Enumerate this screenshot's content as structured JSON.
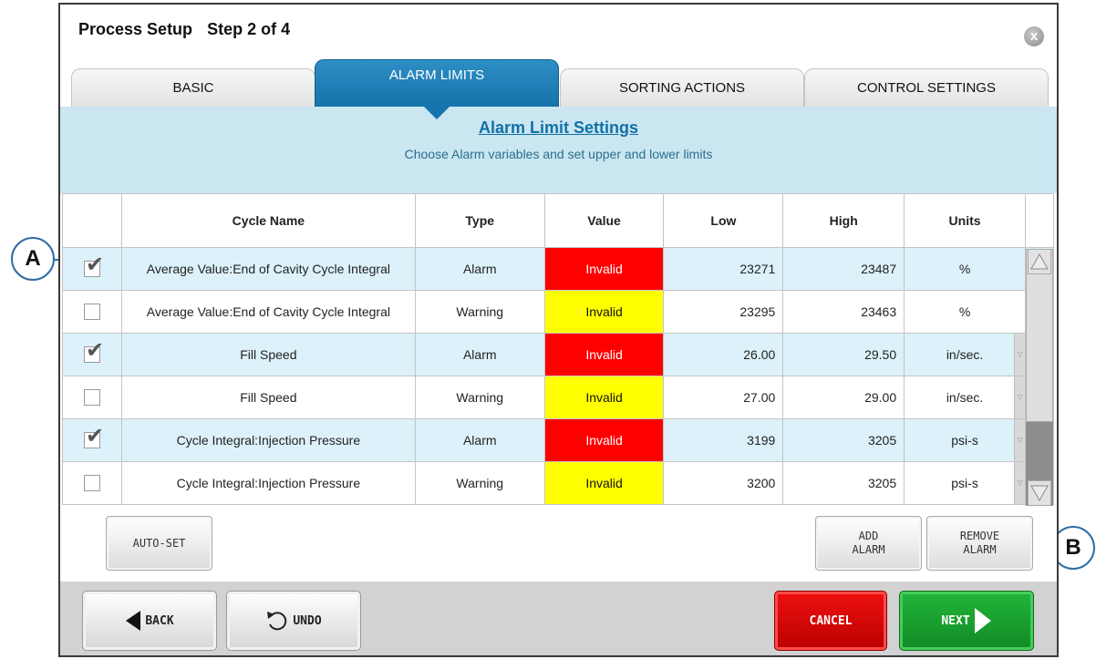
{
  "window": {
    "title": "Process Setup",
    "step": "Step 2 of 4",
    "close_glyph": "x"
  },
  "tabs": [
    {
      "label": "BASIC",
      "active": false
    },
    {
      "label": "ALARM LIMITS",
      "active": true
    },
    {
      "label": "SORTING ACTIONS",
      "active": false
    },
    {
      "label": "CONTROL SETTINGS",
      "active": false
    }
  ],
  "header": {
    "title": "Alarm Limit Settings",
    "subtitle": "Choose Alarm variables and set upper and lower limits"
  },
  "table": {
    "columns": [
      "",
      "Cycle Name",
      "Type",
      "Value",
      "Low",
      "High",
      "Units"
    ],
    "rows": [
      {
        "checked": true,
        "name": "Average Value:End of Cavity Cycle Integral",
        "type": "Alarm",
        "value": "Invalid",
        "low": "23271",
        "high": "23487",
        "units": "%",
        "dropdown": false
      },
      {
        "checked": false,
        "name": "Average Value:End of Cavity Cycle Integral",
        "type": "Warning",
        "value": "Invalid",
        "low": "23295",
        "high": "23463",
        "units": "%",
        "dropdown": false
      },
      {
        "checked": true,
        "name": "Fill Speed",
        "type": "Alarm",
        "value": "Invalid",
        "low": "26.00",
        "high": "29.50",
        "units": "in/sec.",
        "dropdown": true
      },
      {
        "checked": false,
        "name": "Fill Speed",
        "type": "Warning",
        "value": "Invalid",
        "low": "27.00",
        "high": "29.00",
        "units": "in/sec.",
        "dropdown": true
      },
      {
        "checked": true,
        "name": "Cycle Integral:Injection Pressure",
        "type": "Alarm",
        "value": "Invalid",
        "low": "3199",
        "high": "3205",
        "units": "psi-s",
        "dropdown": true
      },
      {
        "checked": false,
        "name": "Cycle Integral:Injection Pressure",
        "type": "Warning",
        "value": "Invalid",
        "low": "3200",
        "high": "3205",
        "units": "psi-s",
        "dropdown": true
      }
    ]
  },
  "buttons": {
    "auto_set": "AUTO-SET",
    "add_alarm_1": "ADD",
    "add_alarm_2": "ALARM",
    "remove_alarm_1": "REMOVE",
    "remove_alarm_2": "ALARM",
    "back": "BACK",
    "undo": "UNDO",
    "cancel": "CANCEL",
    "next": "NEXT"
  },
  "callouts": {
    "a": "A",
    "b": "B"
  },
  "colors": {
    "accent_blue": "#1673ab",
    "alarm_red": "#ff0000",
    "warning_yellow": "#ffff00",
    "cancel_red": "#d40000",
    "next_green": "#1aa02e",
    "row_highlight": "#dcf1f9"
  },
  "icons": {
    "close": "close-icon",
    "back": "back-arrow-icon",
    "undo": "undo-icon",
    "next": "next-arrow-icon",
    "check": "checkmark-icon",
    "scroll_up": "scroll-up-arrow-icon",
    "scroll_down": "scroll-down-arrow-icon",
    "dropdown": "dropdown-arrow-icon"
  }
}
